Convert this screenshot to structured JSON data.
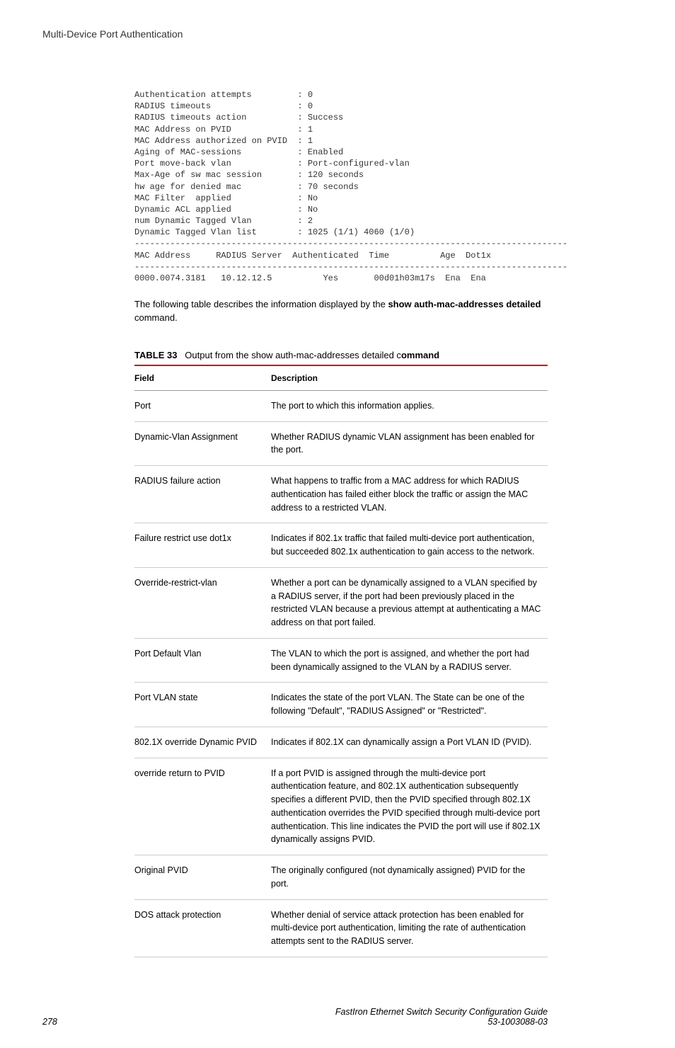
{
  "header": {
    "title": "Multi-Device Port Authentication"
  },
  "cli_output": "Authentication attempts         : 0\nRADIUS timeouts                 : 0\nRADIUS timeouts action          : Success\nMAC Address on PVID             : 1\nMAC Address authorized on PVID  : 1\nAging of MAC-sessions           : Enabled\nPort move-back vlan             : Port-configured-vlan\nMax-Age of sw mac session       : 120 seconds\nhw age for denied mac           : 70 seconds\nMAC Filter  applied             : No\nDynamic ACL applied             : No\nnum Dynamic Tagged Vlan         : 2\nDynamic Tagged Vlan list        : 1025 (1/1) 4060 (1/0)\n-------------------------------------------------------------------------------------\nMAC Address     RADIUS Server  Authenticated  Time          Age  Dot1x\n-------------------------------------------------------------------------------------\n0000.0074.3181   10.12.12.5          Yes       00d01h03m17s  Ena  Ena",
  "intro": {
    "prefix": "The following table describes the information displayed by the ",
    "bold": "show auth-mac-addresses detailed",
    "suffix": " command."
  },
  "table": {
    "caption_label": "TABLE 33",
    "caption_text": "Output from the show auth-mac-addresses detailed c",
    "caption_bold": "ommand",
    "headers": {
      "field": "Field",
      "description": "Description"
    },
    "rows": [
      {
        "field": "Port",
        "description": "The port to which this information applies."
      },
      {
        "field": "Dynamic-Vlan Assignment",
        "description": "Whether RADIUS dynamic VLAN assignment has been enabled for the port."
      },
      {
        "field": "RADIUS failure action",
        "description": "What happens to traffic from a MAC address for which RADIUS authentication has failed either block the traffic or assign the MAC address to a restricted VLAN."
      },
      {
        "field": "Failure restrict use dot1x",
        "description": "Indicates if 802.1x traffic that failed multi-device port authentication, but succeeded 802.1x authentication to gain access to the network."
      },
      {
        "field": "Override-restrict-vlan",
        "description": "Whether a port can be dynamically assigned to a VLAN specified by a RADIUS server, if the port had been previously placed in the restricted VLAN because a previous attempt at authenticating a MAC address on that port failed."
      },
      {
        "field": "Port Default Vlan",
        "description": "The VLAN to which the port is assigned, and whether the port had been dynamically assigned to the VLAN by a RADIUS server."
      },
      {
        "field": "Port VLAN state",
        "description": "Indicates the state of the port VLAN. The State can be one of the following \"Default\", \"RADIUS Assigned\" or \"Restricted\"."
      },
      {
        "field": "802.1X override Dynamic PVID",
        "description": "Indicates if 802.1X can dynamically assign a Port VLAN ID (PVID)."
      },
      {
        "field": "override return to PVID",
        "description": "If a port PVID is assigned through the multi-device port authentication feature, and 802.1X authentication subsequently specifies a different PVID, then the PVID specified through 802.1X authentication overrides the PVID specified through multi-device port authentication. This line indicates the PVID the port will use if 802.1X dynamically assigns PVID."
      },
      {
        "field": "Original PVID",
        "description": "The originally configured (not dynamically assigned) PVID for the port."
      },
      {
        "field": "DOS attack protection",
        "description": "Whether denial of service attack protection has been enabled for multi-device port authentication, limiting the rate of authentication attempts sent to the RADIUS server."
      }
    ]
  },
  "footer": {
    "page_number": "278",
    "doc_title": "FastIron Ethernet Switch Security Configuration Guide",
    "doc_id": "53-1003088-03"
  }
}
